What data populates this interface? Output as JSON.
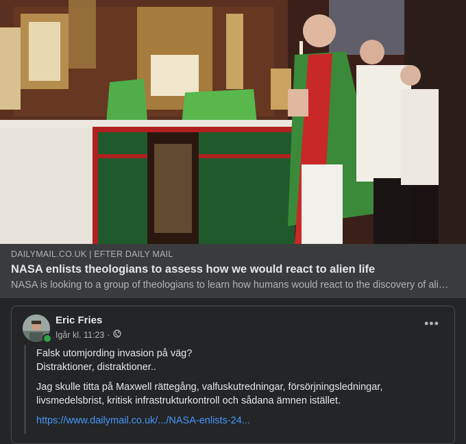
{
  "link_preview": {
    "domain": "DAILYMAIL.CO.UK | EFTER DAILY MAIL",
    "title": "NASA enlists theologians to assess how we would react to alien life",
    "description": "NASA is looking to a group of theologians to learn how humans would react to the discovery of alien life"
  },
  "comment": {
    "author": "Eric Fries",
    "timestamp": "Igår kl. 11:23",
    "separator": "·",
    "privacy_icon": "globe-icon",
    "more_icon": "more-options-icon",
    "more_label": "•••",
    "lines": [
      "Falsk utomjording invasion på väg?",
      "Distraktioner, distraktioner.."
    ],
    "paragraph": "Jag skulle titta på Maxwell rättegång, valfuskutredningar, försörjningsledningar, livsmedelsbrist, kritisk infrastrukturkontroll och sådana ämnen istället.",
    "link": "https://www.dailymail.co.uk/.../NASA-enlists-24..."
  }
}
